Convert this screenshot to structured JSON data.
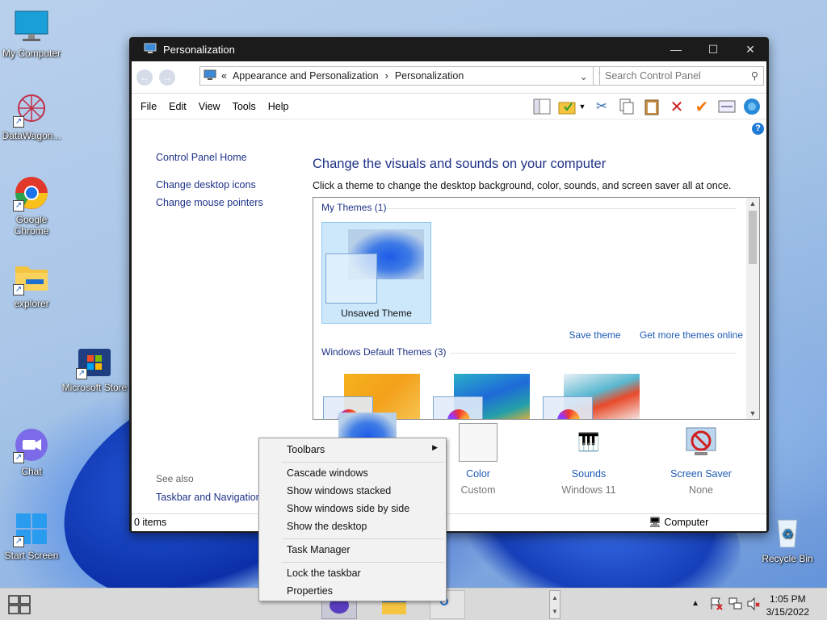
{
  "desktop": {
    "icons": [
      {
        "label": "My Computer"
      },
      {
        "label": "DataWagon..."
      },
      {
        "label": "Google Chrome"
      },
      {
        "label": "explorer"
      },
      {
        "label": "Microsoft Store"
      },
      {
        "label": "Chat"
      },
      {
        "label": "Start Screen"
      },
      {
        "label": "Recycle Bin"
      }
    ]
  },
  "window": {
    "title": "Personalization",
    "address": {
      "prefix": "«",
      "crumb1": "Appearance and Personalization",
      "crumb2": "Personalization"
    },
    "search_placeholder": "Search Control Panel",
    "menu": [
      "File",
      "Edit",
      "View",
      "Tools",
      "Help"
    ],
    "left_links": [
      "Control Panel Home",
      "Change desktop icons",
      "Change mouse pointers"
    ],
    "heading": "Change the visuals and sounds on your computer",
    "subtext": "Click a theme to change the desktop background, color, sounds, and screen saver all at once.",
    "my_themes_label": "My Themes (1)",
    "unsaved_theme": "Unsaved Theme",
    "save_theme": "Save theme",
    "get_more": "Get more themes online",
    "default_themes_label": "Windows Default Themes (3)",
    "see_also": "See also",
    "taskbar_link": "Taskbar and Navigation",
    "bottom": [
      {
        "name": "Color",
        "value": "Custom"
      },
      {
        "name": "Sounds",
        "value": "Windows 11"
      },
      {
        "name": "Screen Saver",
        "value": "None"
      }
    ],
    "status_items": "0 items",
    "status_computer": "Computer"
  },
  "context_menu": {
    "toolbars": "Toolbars",
    "cascade": "Cascade windows",
    "stacked": "Show windows stacked",
    "side_by_side": "Show windows side by side",
    "desktop": "Show the desktop",
    "task_manager": "Task Manager",
    "lock": "Lock the taskbar",
    "properties": "Properties"
  },
  "taskbar": {
    "time": "1:05 PM",
    "date": "3/15/2022"
  },
  "colors": {
    "link": "#1e3287",
    "accent_link": "#1e5bb4",
    "selection": "#cde8fb"
  }
}
